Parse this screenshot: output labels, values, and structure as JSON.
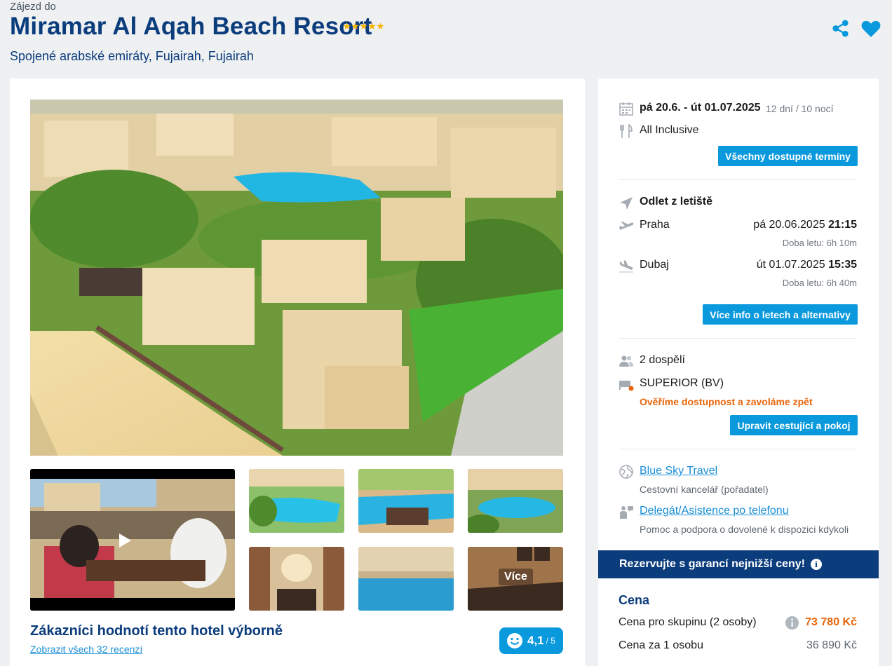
{
  "header": {
    "pretitle": "Zájezd do",
    "title": "Miramar Al Aqah Beach Resort",
    "stars": 5,
    "location": "Spojené arabské emiráty, Fujairah, Fujairah"
  },
  "gallery": {
    "more_label": "Více"
  },
  "reviews": {
    "title": "Zákazníci hodnotí tento hotel výborně",
    "link": "Zobrazit všech 32 recenzí",
    "rating": "4,1",
    "rating_max": "/ 5"
  },
  "booking": {
    "dates": "pá 20.6. - út 01.07.2025",
    "duration": "12 dní / 10 nocí",
    "board": "All Inclusive",
    "all_dates_button": "Všechny dostupné termíny",
    "departure_heading": "Odlet z letiště",
    "outbound": {
      "city": "Praha",
      "date": "pá 20.06.2025",
      "time": "21:15",
      "duration": "Doba letu: 6h 10m"
    },
    "return": {
      "city": "Dubaj",
      "date": "út 01.07.2025",
      "time": "15:35",
      "duration": "Doba letu: 6h 40m"
    },
    "flights_button": "Více info o letech a alternativy",
    "travelers": "2 dospělí",
    "room": "SUPERIOR (BV)",
    "availability_note": "Ověříme dostupnost a zavoláme zpět",
    "edit_button": "Upravit cestující a pokoj",
    "agency_name": "Blue Sky Travel",
    "agency_desc": "Cestovní kancelář (pořadatel)",
    "delegate_name": "Delegát/Asistence po telefonu",
    "delegate_desc": "Pomoc a podpora o dovolené k dispozici kdykoli",
    "banner": "Rezervujte s garancí nejnižší ceny!",
    "price_heading": "Cena",
    "group_price_label": "Cena pro skupinu (2 osoby)",
    "group_price": "73 780 Kč",
    "per_person_label": "Cena za 1 osobu",
    "per_person_price": "36 890 Kč"
  },
  "colors": {
    "brand_blue": "#0b3c7c",
    "accent_blue": "#0a99dd",
    "orange": "#e8650a",
    "star": "#f5b400"
  }
}
